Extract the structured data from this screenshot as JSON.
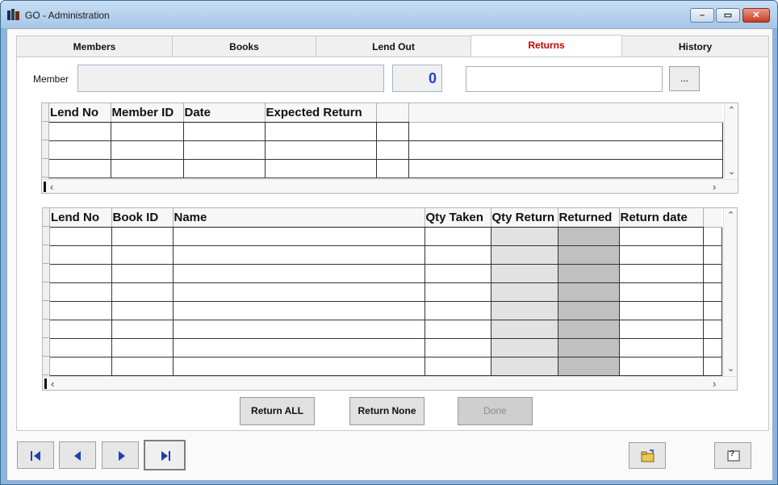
{
  "window": {
    "title": "GO - Administration"
  },
  "tabs": [
    {
      "label": "Members"
    },
    {
      "label": "Books"
    },
    {
      "label": "Lend Out"
    },
    {
      "label": "Returns"
    },
    {
      "label": "History"
    }
  ],
  "member": {
    "label": "Member",
    "name_value": "",
    "count_value": "0",
    "search_value": "",
    "browse_label": "..."
  },
  "lends_grid": {
    "columns": [
      "Lend No",
      "Member ID",
      "Date",
      "Expected Return",
      ""
    ],
    "rows": 3
  },
  "items_grid": {
    "columns": [
      "Lend No",
      "Book ID",
      "Name",
      "Qty Taken",
      "Qty Return",
      "Returned",
      "Return date"
    ],
    "rows": 8
  },
  "actions": {
    "return_all": "Return ALL",
    "return_none": "Return None",
    "done": "Done"
  },
  "toolbar": {
    "help_label": "?"
  },
  "colors": {
    "active_tab": "#cc0000",
    "count_text": "#1e3fd1",
    "accent": "#1f3fae"
  }
}
